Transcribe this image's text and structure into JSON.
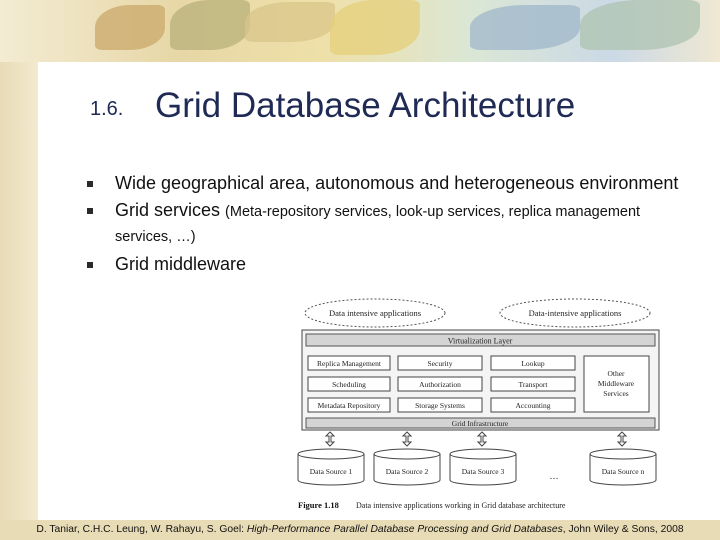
{
  "slide": {
    "number": "1.6.",
    "title": "Grid Database Architecture"
  },
  "bullets": [
    {
      "text": "Wide geographical area, autonomous and heterogeneous environment"
    },
    {
      "text": "Grid services ",
      "small": "(Meta-repository services, look-up services, replica management services, …)"
    },
    {
      "text": "Grid middleware"
    }
  ],
  "diagram": {
    "app_left": "Data intensive applications",
    "app_right": "Data-intensive applications",
    "virtualization_layer": "Virtualization Layer",
    "services": [
      "Replica Management",
      "Security",
      "Lookup",
      "Scheduling",
      "Authorization",
      "Transport",
      "Metadata Repository",
      "Storage Systems",
      "Accounting"
    ],
    "other_services": [
      "Other",
      "Middleware",
      "Services"
    ],
    "grid_infrastructure": "Grid Infrastructure",
    "data_sources": [
      "Data Source 1",
      "Data Source 2",
      "Data Source 3",
      "Data Source n"
    ],
    "ellipsis": "…",
    "caption_label": "Figure 1.18",
    "caption_text": "Data intensive applications working in Grid database architecture"
  },
  "footer": {
    "authors": "D. Taniar, C.H.C. Leung, W. Rahayu, S. Goel: ",
    "book": "High-Performance Parallel Database Processing and Grid Databases",
    "publisher": ", John Wiley & Sons, 2008"
  }
}
